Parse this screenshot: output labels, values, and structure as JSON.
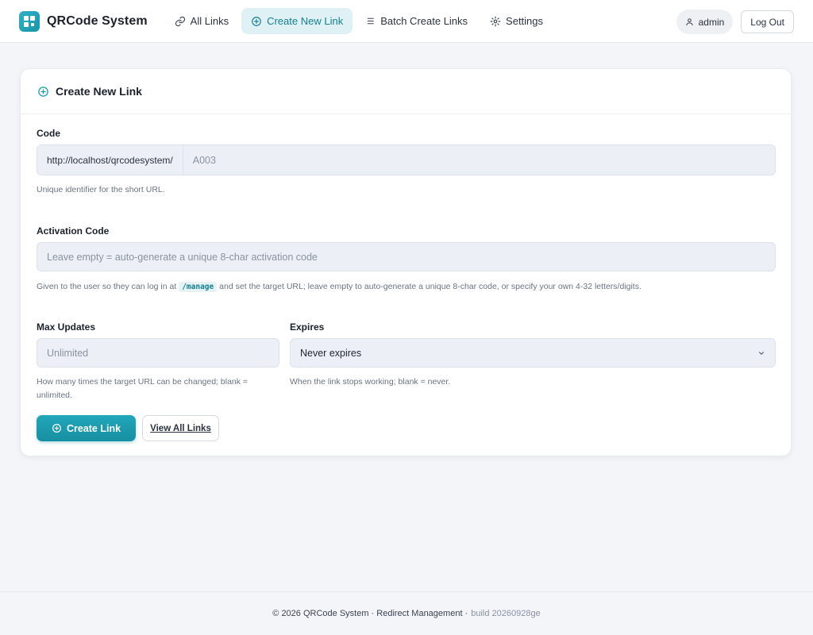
{
  "brand": {
    "name": "QRCode System",
    "accent": "#1a9aae"
  },
  "nav": {
    "items": [
      {
        "label": "All Links",
        "icon": "link-icon"
      },
      {
        "label": "Create New Link",
        "icon": "plus-circle-icon",
        "active": true
      },
      {
        "label": "Batch Create Links",
        "icon": "list-icon"
      },
      {
        "label": "Settings",
        "icon": "gear-icon"
      }
    ]
  },
  "user": {
    "name": "admin",
    "logout_label": "Log Out"
  },
  "card": {
    "title": "Create New Link",
    "code": {
      "label": "Code",
      "prefix": "http://localhost/qrcodesystem/",
      "placeholder": "A003",
      "help": "Unique identifier for the short URL."
    },
    "activation": {
      "label": "Activation Code",
      "placeholder": "Leave empty = auto-generate a unique 8-char activation code",
      "help_before": "Given to the user so they can log in at",
      "help_code": "/manage",
      "help_after": "and set the target URL; leave empty to auto-generate a unique 8-char code, or specify your own 4-32 letters/digits."
    },
    "max_updates": {
      "label": "Max Updates",
      "placeholder": "Unlimited",
      "help": "How many times the target URL can be changed; blank = unlimited."
    },
    "expires": {
      "label": "Expires",
      "selected": "Never expires",
      "help": "When the link stops working; blank = never."
    },
    "create_label": "Create Link",
    "view_all_label": "View All Links"
  },
  "footer": {
    "text": "© 2026 QRCode System · Redirect Management ·",
    "build": "build 20260928ge"
  }
}
